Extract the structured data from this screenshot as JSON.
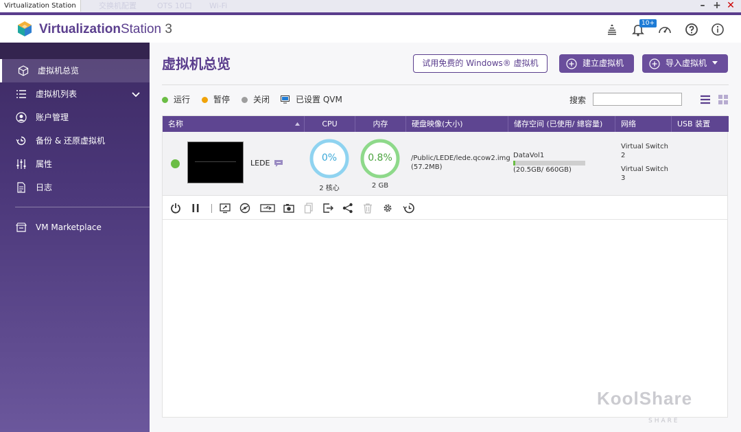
{
  "window": {
    "title": "Virtualization Station",
    "ghost_tabs": [
      "交换机配置",
      "OTS 10口",
      "Wi-Fi"
    ]
  },
  "header": {
    "brand_bold": "Virtualization",
    "brand_rest": "Station",
    "brand_version": " 3",
    "notification_badge": "10+"
  },
  "sidebar": {
    "items": [
      {
        "label": "虚拟机总览",
        "icon": "overview-icon",
        "active": true
      },
      {
        "label": "虚拟机列表",
        "icon": "list-icon",
        "expandable": true
      },
      {
        "label": "账户管理",
        "icon": "account-icon"
      },
      {
        "label": "备份 & 还原虚拟机",
        "icon": "backup-icon"
      },
      {
        "label": "属性",
        "icon": "settings-sliders-icon"
      },
      {
        "label": "日志",
        "icon": "log-icon"
      },
      {
        "label": "VM Marketplace",
        "icon": "marketplace-icon"
      }
    ]
  },
  "main": {
    "title": "虚拟机总览",
    "try_windows_button": "试用免费的 Windows® 虚拟机",
    "create_vm_button": "建立虚拟机",
    "import_vm_button": "导入虚拟机",
    "legend": {
      "running": "运行",
      "paused": "暂停",
      "off": "关闭",
      "qvm": "已设置 QVM"
    },
    "search_label": "搜索",
    "search_value": ""
  },
  "table": {
    "headers": {
      "name": "名称",
      "cpu": "CPU",
      "memory": "内存",
      "disk": "硬盘映像(大小)",
      "storage": "储存空间 (已使用/ 總容量)",
      "network": "网络",
      "usb": "USB 装置"
    },
    "rows": [
      {
        "name": "LEDE",
        "status": "running",
        "cpu_percent": "0%",
        "cpu_sub": "2 核心",
        "mem_percent": "0.8%",
        "mem_sub": "2 GB",
        "disk": "/Public/LEDE/lede.qcow2.img (57.2MB)",
        "storage_name": "DataVol1",
        "storage_usage": "(20.5GB/ 660GB)",
        "storage_fraction": 0.031,
        "network_1": "Virtual Switch 2",
        "network_2": "Virtual Switch 3",
        "usb": ""
      }
    ]
  },
  "watermark": {
    "main": "KoolShare",
    "sub": "SHARE"
  },
  "colors": {
    "brand_purple": "#5a3d8d",
    "running_green": "#6bbd45",
    "paused_orange": "#f0a30a",
    "off_gray": "#9e9e9e",
    "cpu_ring_blue": "#8fd3f0",
    "mem_ring_green": "#8ed98a"
  }
}
